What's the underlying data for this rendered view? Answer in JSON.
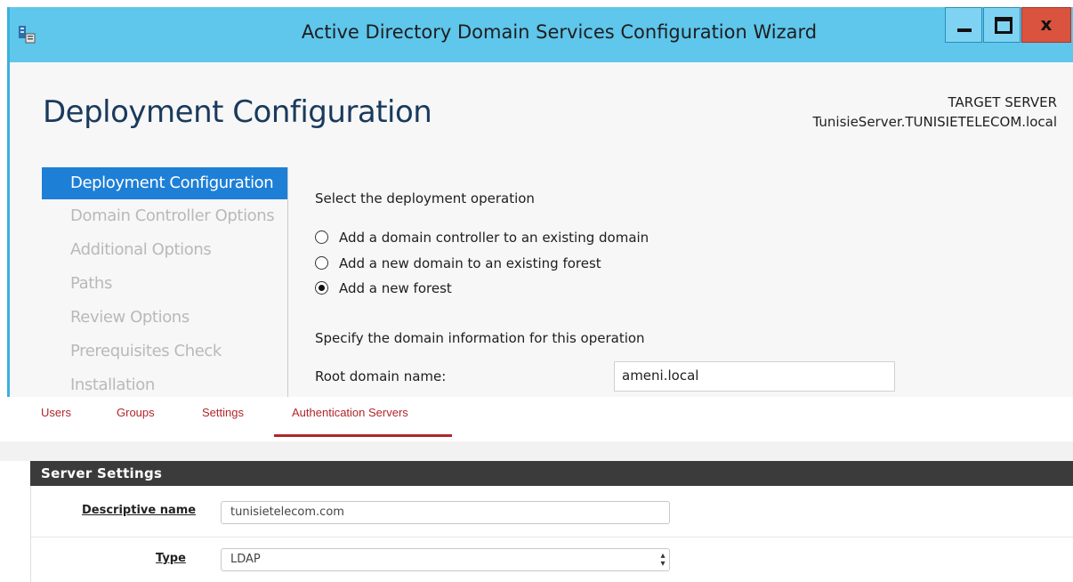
{
  "window": {
    "title": "Active Directory Domain Services Configuration Wizard",
    "close_glyph": "x"
  },
  "page": {
    "heading": "Deployment Configuration",
    "target_server_label": "TARGET SERVER",
    "target_server_value": "TunisieServer.TUNISIETELECOM.local"
  },
  "steps": [
    {
      "label": "Deployment Configuration",
      "active": true
    },
    {
      "label": "Domain Controller Options",
      "active": false
    },
    {
      "label": "Additional Options",
      "active": false
    },
    {
      "label": "Paths",
      "active": false
    },
    {
      "label": "Review Options",
      "active": false
    },
    {
      "label": "Prerequisites Check",
      "active": false
    },
    {
      "label": "Installation",
      "active": false
    }
  ],
  "deployment": {
    "select_label": "Select the deployment operation",
    "options": [
      {
        "label": "Add a domain controller to an existing domain",
        "checked": false
      },
      {
        "label": "Add a new domain to an existing forest",
        "checked": false
      },
      {
        "label": "Add a new forest",
        "checked": true
      }
    ],
    "specify_label": "Specify the domain information for this operation",
    "root_domain_label": "Root domain name:",
    "root_domain_value": "ameni.local"
  },
  "admin_tabs": [
    {
      "label": "Users",
      "active": false
    },
    {
      "label": "Groups",
      "active": false
    },
    {
      "label": "Settings",
      "active": false
    },
    {
      "label": "Authentication Servers",
      "active": true
    }
  ],
  "server_settings": {
    "header": "Server Settings",
    "descriptive_name_label": "Descriptive name",
    "descriptive_name_value": "tunisietelecom.com",
    "type_label": "Type",
    "type_value": "LDAP"
  },
  "colors": {
    "titlebar": "#5fc6ec",
    "active_step": "#1e7fd6",
    "tab_red": "#b0262c",
    "panel_header": "#3b3b3b"
  }
}
